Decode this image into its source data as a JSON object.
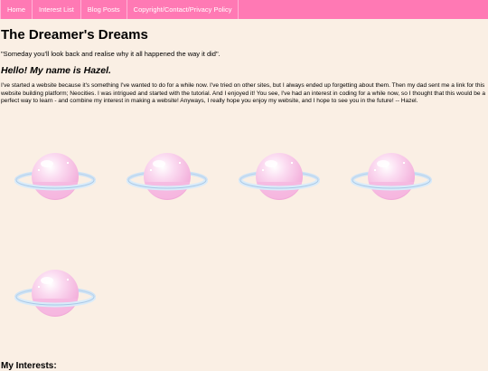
{
  "nav": {
    "items": [
      {
        "label": "Home"
      },
      {
        "label": "Interest List"
      },
      {
        "label": "Blog Posts"
      },
      {
        "label": "Copyright/Contact/Privacy Policy"
      }
    ]
  },
  "page": {
    "title": "The Dreamer's Dreams",
    "quote": "\"Someday you'll look back and realise why it all happened the way it did\".",
    "greeting": "Hello! My name is Hazel.",
    "intro": "I've started a website because it's something I've wanted to do for a while now. I've tried on other sites, but I always ended up forgetting about them. Then my dad sent me a link for this website building platform; Neocities. I was intrigued and started with the tutorial. And I enjoyed it! You see, I've had an interest in coding for a while now, so I thought that this would be a perfect way to learn - and combine my interest in making a website! Anyways, I really hope you enjoy my website, and I hope to see you in the future! -- Hazel.",
    "interests_heading": "My Interests:"
  },
  "decor": {
    "planet_icon": "pink-planet-icon",
    "planet_color": "#f7c3e6",
    "ring_color": "#cfe3f5"
  }
}
